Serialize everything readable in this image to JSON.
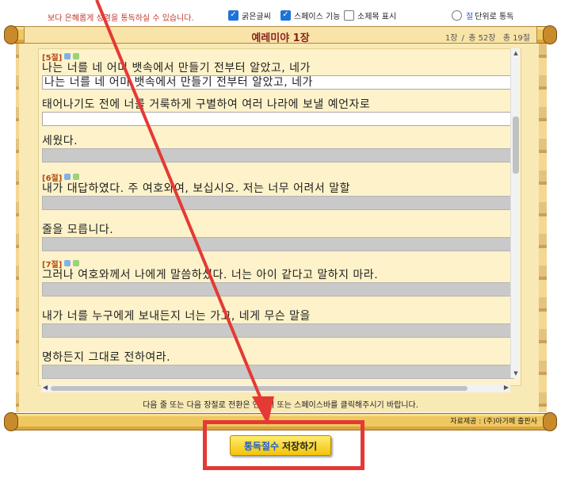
{
  "top": {
    "note": "보다 은혜롭게 성경을 통독하실 수 있습니다.",
    "bold_option": {
      "label": "굵은글씨",
      "checked": true
    },
    "space_option": {
      "label": "스페이스 기능",
      "checked": true
    },
    "subtitle_option": {
      "label": "소제목 표시",
      "checked": false
    },
    "verse_mode": {
      "accent": "절",
      "label": "단위로 통독",
      "selected": false
    }
  },
  "title": "예레미야 1장",
  "page_info": {
    "chapter": "1장",
    "separator": "/",
    "total": "총 52장",
    "verses": "총 19절"
  },
  "verses": [
    {
      "label": "[5절]",
      "lines": [
        {
          "text": "나는 너를 네 어미 뱃속에서 만들기 전부터 알았고, 네가",
          "typed": "나는 너를 네 어미 뱃속에서 만들기 전부터 알았고, 네가",
          "state": "typed"
        },
        {
          "text": "태어나기도 전에 너를 거룩하게 구별하여 여러 나라에 보낼 예언자로",
          "typed": "",
          "state": "active"
        },
        {
          "text": "세웠다.",
          "typed": "",
          "state": "inactive"
        }
      ]
    },
    {
      "label": "[6절]",
      "lines": [
        {
          "text": "내가 대답하였다. 주 여호와여, 보십시오. 저는 너무 어려서 말할",
          "typed": "",
          "state": "inactive"
        },
        {
          "text": "줄을 모릅니다.",
          "typed": "",
          "state": "inactive"
        }
      ]
    },
    {
      "label": "[7절]",
      "lines": [
        {
          "text": "그러나 여호와께서 나에게 말씀하셨다. 너는 아이 같다고 말하지 마라.",
          "typed": "",
          "state": "inactive"
        },
        {
          "text": "내가 너를 누구에게 보내든지 너는 가고, 네게 무슨 말을",
          "typed": "",
          "state": "inactive"
        },
        {
          "text": "명하든지 그대로 전하여라.",
          "typed": "",
          "state": "inactive"
        }
      ]
    }
  ],
  "hint": "다음 줄 또는 다음 장절로 전환은 엔터키 또는 스페이스바를 클릭해주시기 바랍니다.",
  "credit": "자료제공 : (주)아가페 출판사",
  "save_button": {
    "highlight": "통독절수",
    "label": "저장하기"
  },
  "colors": {
    "annotation": "#e53935",
    "title": "#8a1f1f",
    "verse_label": "#b54a12",
    "button": "#f3c40a"
  }
}
